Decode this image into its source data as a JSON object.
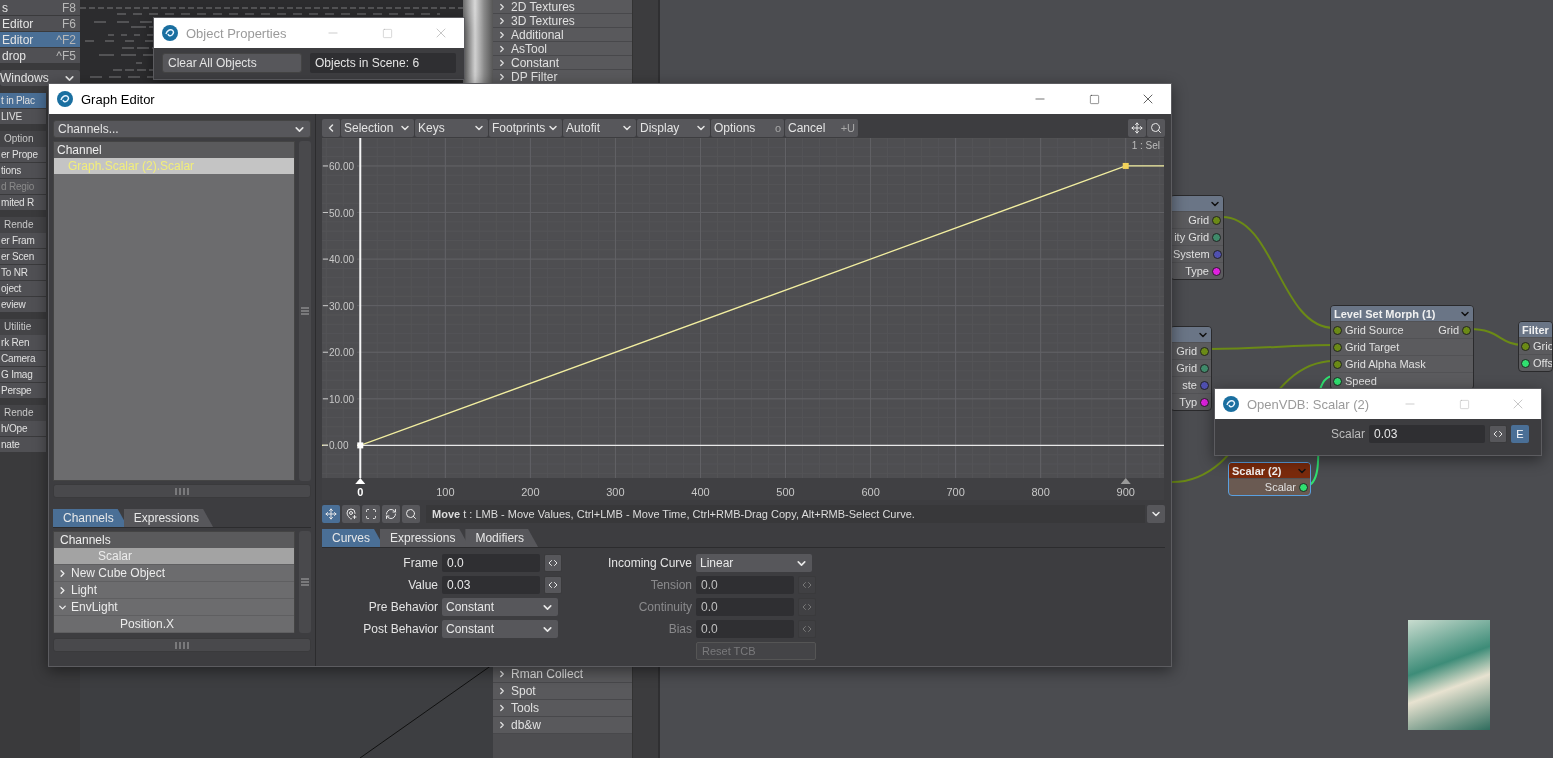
{
  "main_menu": {
    "items": [
      {
        "label": "s",
        "shortcut": "F8",
        "selected": false
      },
      {
        "label": "Editor",
        "shortcut": "F6",
        "selected": false
      },
      {
        "label": "Editor",
        "shortcut": "^F2",
        "selected": true
      },
      {
        "label": "drop",
        "shortcut": "^F5",
        "selected": false
      }
    ],
    "windows_dropdown": "Windows",
    "side_items": [
      {
        "kind": "button",
        "label": "t in Plac",
        "selected": true,
        "disabled": false
      },
      {
        "kind": "button",
        "label": "LIVE",
        "selected": false,
        "disabled": false
      },
      {
        "kind": "header",
        "label": "Option"
      },
      {
        "kind": "button",
        "label": "er Prope",
        "selected": false,
        "disabled": false
      },
      {
        "kind": "button",
        "label": "tions",
        "selected": false,
        "disabled": false
      },
      {
        "kind": "button",
        "label": "d Regio",
        "selected": false,
        "disabled": true
      },
      {
        "kind": "button",
        "label": "mited R",
        "selected": false,
        "disabled": false
      },
      {
        "kind": "header",
        "label": "Rende"
      },
      {
        "kind": "button",
        "label": "er Fram",
        "selected": false,
        "disabled": false
      },
      {
        "kind": "button",
        "label": "er Scen",
        "selected": false,
        "disabled": false
      },
      {
        "kind": "button",
        "label": "To NR",
        "selected": false,
        "disabled": false
      },
      {
        "kind": "button",
        "label": "oject",
        "selected": false,
        "disabled": false
      },
      {
        "kind": "button",
        "label": "eview",
        "selected": false,
        "disabled": false
      },
      {
        "kind": "header",
        "label": "Utilitie"
      },
      {
        "kind": "button",
        "label": "rk Ren",
        "selected": false,
        "disabled": false
      },
      {
        "kind": "button",
        "label": "Camera",
        "selected": false,
        "disabled": false
      },
      {
        "kind": "button",
        "label": "G Imag",
        "selected": false,
        "disabled": false
      },
      {
        "kind": "button",
        "label": "Perspe",
        "selected": false,
        "disabled": false
      },
      {
        "kind": "header",
        "label": "Rende"
      },
      {
        "kind": "button",
        "label": "h/Ope",
        "selected": false,
        "disabled": false
      },
      {
        "kind": "button",
        "label": "nate",
        "selected": false,
        "disabled": false
      }
    ]
  },
  "node_list_top": [
    "2D Textures",
    "3D Textures",
    "Additional",
    "AsTool",
    "Constant",
    "DP Filter"
  ],
  "node_list_bottom": [
    "Rman Collect",
    "Spot",
    "Tools",
    "db&w"
  ],
  "object_properties": {
    "title": "Object Properties",
    "active": false,
    "clear_button": "Clear All Objects",
    "objects_count": "Objects in Scene: 6"
  },
  "graph_editor": {
    "title": "Graph Editor",
    "active": true,
    "channels_dropdown": "Channels...",
    "channel_header": "Channel",
    "channels": [
      {
        "label": "Graph.Scalar (2).Scalar",
        "selected": true
      }
    ],
    "left_tabs": [
      {
        "label": "Channels",
        "selected": true
      },
      {
        "label": "Expressions",
        "selected": false
      }
    ],
    "tree": {
      "header": "Channels",
      "items": [
        {
          "label": "Scalar",
          "selected": true
        },
        {
          "label": "New Cube Object",
          "selected": false,
          "expanded": false
        },
        {
          "label": "Light",
          "selected": false,
          "expanded": false
        },
        {
          "label": "EnvLight",
          "selected": false,
          "expanded": true,
          "children": [
            {
              "label": "Position.X",
              "selected": false
            }
          ]
        }
      ]
    },
    "toolbar": [
      {
        "kind": "menu",
        "label": "Selection"
      },
      {
        "kind": "menu",
        "label": "Keys"
      },
      {
        "kind": "menu",
        "label": "Footprints"
      },
      {
        "kind": "menu",
        "label": "Autofit"
      },
      {
        "kind": "menu",
        "label": "Display"
      },
      {
        "kind": "command",
        "label": "Options",
        "key": "o"
      },
      {
        "kind": "command",
        "label": "Cancel",
        "key": "+U"
      }
    ],
    "chart_data": {
      "type": "line",
      "x": [
        -45,
        0,
        900,
        945
      ],
      "grid": true,
      "series": [
        {
          "color": "#f2eea0",
          "marker": "square",
          "values": [
            0,
            0,
            60,
            60
          ]
        }
      ],
      "xlim": [
        -45,
        945
      ],
      "ylim": [
        -7,
        66
      ],
      "xticks": [
        0,
        100,
        200,
        300,
        400,
        500,
        600,
        700,
        800,
        900
      ],
      "yticks": [
        {
          "value": 0,
          "label": "0.00"
        },
        {
          "value": 10,
          "label": "10.00"
        },
        {
          "value": 20,
          "label": "20.00"
        },
        {
          "value": 30,
          "label": "30.00"
        },
        {
          "value": 40,
          "label": "40.00"
        },
        {
          "value": 50,
          "label": "50.00"
        },
        {
          "value": 60,
          "label": "60.00"
        }
      ],
      "annotations": [
        "1 : Sel"
      ]
    },
    "tools": [
      {
        "kind": "move",
        "selected": true
      },
      {
        "kind": "add",
        "selected": false
      },
      {
        "kind": "frame",
        "selected": false
      },
      {
        "kind": "refresh",
        "selected": false
      },
      {
        "kind": "zoom",
        "selected": false
      }
    ],
    "status": "**Move** t :  LMB - Move Values, Ctrl+LMB - Move Time, Ctrl+RMB-Drag Copy, Alt+RMB-Select Curve.",
    "bottom_tabs": [
      {
        "label": "Curves",
        "selected": true
      },
      {
        "label": "Expressions",
        "selected": false
      },
      {
        "label": "Modifiers",
        "selected": false
      }
    ],
    "form_left": [
      {
        "label": "Frame",
        "kind": "number",
        "value": "0.0",
        "disabled": false
      },
      {
        "label": "Value",
        "kind": "number",
        "value": "0.03",
        "disabled": false
      },
      {
        "label": "Pre Behavior",
        "kind": "select",
        "value": "Constant",
        "disabled": false
      },
      {
        "label": "Post Behavior",
        "kind": "select",
        "value": "Constant",
        "disabled": false
      }
    ],
    "form_right": [
      {
        "label": "Incoming Curve",
        "kind": "select",
        "value": "Linear",
        "disabled": false
      },
      {
        "label": "Tension",
        "kind": "number",
        "value": "0.0",
        "disabled": true
      },
      {
        "label": "Continuity",
        "kind": "number",
        "value": "0.0",
        "disabled": true
      },
      {
        "label": "Bias",
        "kind": "number",
        "value": "0.0",
        "disabled": true
      }
    ],
    "reset_button": {
      "label": "Reset TCB",
      "disabled": true
    }
  },
  "nodes": [
    {
      "selected": false,
      "color": "#6a7586",
      "rows": [
        {
          "out": {
            "label": "Grid",
            "color": "#6b8a16"
          }
        },
        {
          "out": {
            "label": "ity Grid",
            "color": "#3f8a6a"
          }
        },
        {
          "out": {
            "label": "System",
            "color": "#5050b0"
          }
        },
        {
          "out": {
            "label": "Type",
            "color": "#e020e0"
          }
        }
      ]
    },
    {
      "selected": false,
      "color": "#6a7586",
      "rows": [
        {
          "out": {
            "label": "Grid",
            "color": "#6b8a16"
          }
        },
        {
          "out": {
            "label": "Grid",
            "color": "#3f8a6a"
          }
        },
        {
          "out": {
            "label": "ste",
            "color": "#5050b0"
          }
        },
        {
          "out": {
            "label": "Typ",
            "color": "#e020e0"
          }
        }
      ]
    },
    {
      "title": "Level Set Morph (1)",
      "selected": false,
      "color": "#6a7586",
      "rows": [
        {
          "in": {
            "label": "Grid Source",
            "color": "#6b8a16"
          },
          "out": {
            "label": "Grid",
            "color": "#6b8a16"
          }
        },
        {
          "in": {
            "label": "Grid Target",
            "color": "#6b8a16"
          }
        },
        {
          "in": {
            "label": "Grid Alpha Mask",
            "color": "#6b8a16"
          }
        },
        {
          "in": {
            "label": "Speed",
            "color": "#30e070"
          }
        }
      ]
    },
    {
      "title": "Filter",
      "selected": false,
      "color": "#6a7586",
      "rows": [
        {
          "in": {
            "label": "Gric",
            "color": "#6b8a16"
          }
        },
        {
          "in": {
            "label": "Offs",
            "color": "#30e070"
          }
        }
      ]
    },
    {
      "title": "Scalar (2)",
      "selected": true,
      "color": "#7a2a0c",
      "rows": [
        {
          "out": {
            "label": "Scalar",
            "color": "#30e070"
          }
        }
      ]
    }
  ],
  "openvdb": {
    "title": "OpenVDB: Scalar (2)",
    "active": false,
    "label": "Scalar",
    "value": "0.03",
    "e_button": "E"
  }
}
